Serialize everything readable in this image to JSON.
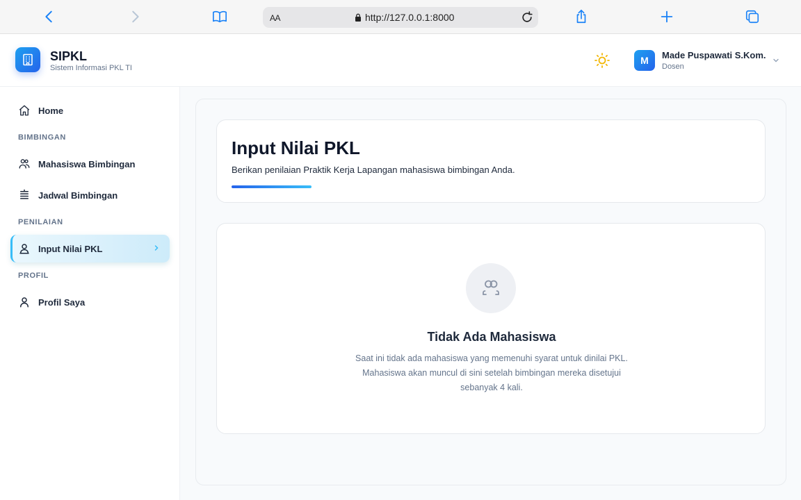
{
  "browser": {
    "aa_label": "AA",
    "url": "http://127.0.0.1:8000"
  },
  "header": {
    "brand_title": "SIPKL",
    "brand_subtitle": "Sistem Informasi PKL TI",
    "user_initial": "M",
    "user_name": "Made Puspawati S.Kom.",
    "user_role": "Dosen"
  },
  "sidebar": {
    "home_label": "Home",
    "section_bimbingan": "BIMBINGAN",
    "mahasiswa_label": "Mahasiswa Bimbingan",
    "jadwal_label": "Jadwal Bimbingan",
    "section_penilaian": "PENILAIAN",
    "input_nilai_label": "Input Nilai PKL",
    "section_profil": "PROFIL",
    "profil_label": "Profil Saya"
  },
  "main": {
    "title": "Input Nilai PKL",
    "subtitle": "Berikan penilaian Praktik Kerja Lapangan mahasiswa bimbingan Anda.",
    "empty_title": "Tidak Ada Mahasiswa",
    "empty_description": "Saat ini tidak ada mahasiswa yang memenuhi syarat untuk dinilai PKL. Mahasiswa akan muncul di sini setelah bimbingan mereka disetujui sebanyak 4 kali."
  },
  "colors": {
    "accent": "#2563eb",
    "accent_light": "#38bdf8",
    "browser_blue": "#1a82f7",
    "sun_yellow": "#f2b705"
  }
}
